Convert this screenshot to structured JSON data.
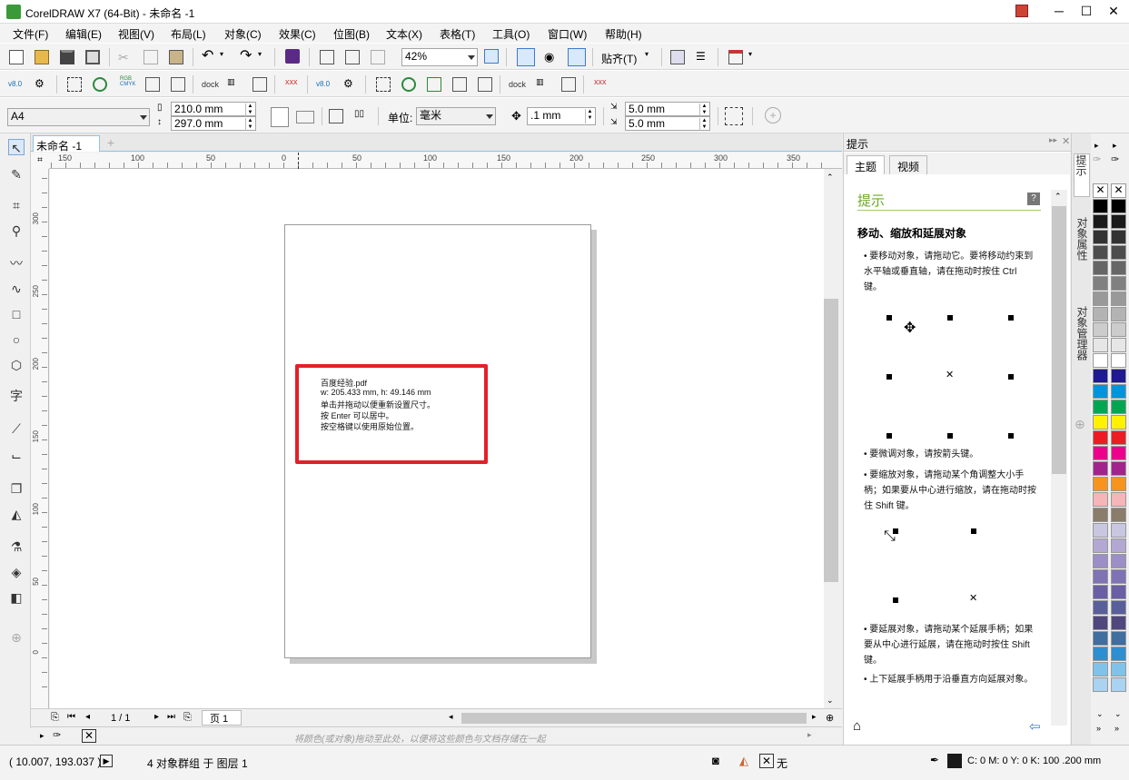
{
  "window": {
    "title": "CorelDRAW X7 (64-Bit) - 未命名 -1",
    "minimize": "─",
    "maximize": "☐",
    "close": "✕"
  },
  "menu": [
    "文件(F)",
    "编辑(E)",
    "视图(V)",
    "布局(L)",
    "对象(C)",
    "效果(C)",
    "位图(B)",
    "文本(X)",
    "表格(T)",
    "工具(O)",
    "窗口(W)",
    "帮助(H)"
  ],
  "toolbar": {
    "zoom": "42%",
    "snap": "贴齐(T)",
    "v80a": "v8.0",
    "v80b": "v8.0",
    "dock1": "dock",
    "dock2": "dock",
    "rgb": "RGB",
    "cmyk": "CMYK"
  },
  "property_bar": {
    "page_size": "A4",
    "width": "210.0 mm",
    "height": "297.0 mm",
    "unit_label": "单位:",
    "unit": "毫米",
    "nudge": ".1 mm",
    "dup_x": "5.0 mm",
    "dup_y": "5.0 mm"
  },
  "document_tab": "未命名 -1",
  "ruler_h_ticks": [
    "150",
    "100",
    "50",
    "0",
    "50",
    "100",
    "150",
    "200",
    "250",
    "300",
    "350"
  ],
  "ruler_v_ticks": [
    "300",
    "250",
    "200",
    "150",
    "100",
    "50",
    "0"
  ],
  "tooltip": {
    "filename": "百度经验.pdf",
    "dims": "w: 205.433 mm, h: 49.146 mm",
    "line1": "单击并拖动以便重新设置尺寸。",
    "line2": "按 Enter 可以居中。",
    "line3": "按空格键以使用原始位置。"
  },
  "page_nav": {
    "count": "1 / 1",
    "tab": "页 1"
  },
  "palette_hint": "将颜色(或对象)拖动至此处，以便将这些颜色与文档存储在一起",
  "panel": {
    "header": "提示",
    "tab_topic": "主题",
    "tab_video": "视频",
    "heading": "提示",
    "subheading": "移动、缩放和延展对象",
    "p1": "• 要移动对象，请拖动它。要将移动约束到水平轴或垂直轴，请在拖动时按住 Ctrl 键。",
    "p2": "• 要微调对象，请按箭头键。",
    "p3": "• 要缩放对象，请拖动某个角调整大小手柄；如果要从中心进行缩放，请在拖动时按住 Shift 键。",
    "p4": "• 要延展对象，请拖动某个延展手柄；如果要从中心进行延展，请在拖动时按住 Shift 键。",
    "p5": "• 上下延展手柄用于沿垂直方向延展对象。"
  },
  "side_tabs": [
    "提示",
    "对象属性",
    "对象管理器"
  ],
  "palette_colors": [
    "#000000",
    "#1a1a1a",
    "#333333",
    "#4d4d4d",
    "#666666",
    "#808080",
    "#999999",
    "#b3b3b3",
    "#cccccc",
    "#e6e6e6",
    "#ffffff",
    "#1f1a8f",
    "#0095d8",
    "#00a651",
    "#fff200",
    "#ed1c24",
    "#ec008c",
    "#a3238e",
    "#f7941d",
    "#f5b5b9",
    "#8b7d6b",
    "#c8c6e0",
    "#b3a8d3",
    "#9b8fc6",
    "#7f73b5",
    "#6a5fa5",
    "#585f9a",
    "#50477e",
    "#3f6e9f",
    "#2b8fd1",
    "#7fc3ea",
    "#a9d3f0"
  ],
  "status": {
    "coords": "( 10.007, 193.037 )",
    "selection": "4 对象群组 于 图层 1",
    "fill": "无",
    "outline": "C: 0 M: 0 Y: 0 K: 100  .200 mm"
  }
}
